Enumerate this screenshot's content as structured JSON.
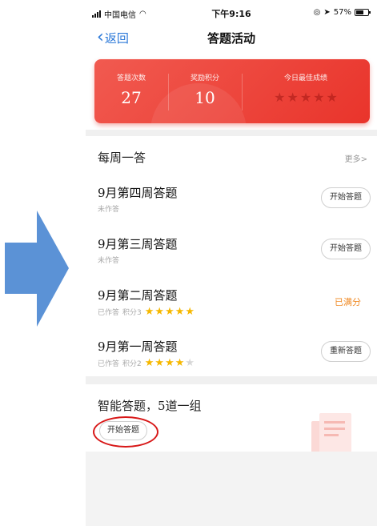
{
  "annotation": {
    "arrow_color": "#5b92d6",
    "highlight_color": "#d81818"
  },
  "status_bar": {
    "carrier": "中国电信",
    "time": "下午9:16",
    "battery": "57%"
  },
  "nav": {
    "back_label": "返回",
    "title": "答题活动"
  },
  "stats": {
    "card_color": "#ee4139",
    "items": [
      {
        "label": "答题次数",
        "value": "27"
      },
      {
        "label": "奖励积分",
        "value": "10"
      },
      {
        "label": "今日最佳成绩",
        "stars": 0,
        "max_stars": 5
      }
    ]
  },
  "weekly": {
    "title": "每周一答",
    "more_label": "更多>",
    "rows": [
      {
        "title": "9月第四周答题",
        "status": "未作答",
        "action": "开始答题"
      },
      {
        "title": "9月第三周答题",
        "status": "未作答",
        "action": "开始答题"
      },
      {
        "title": "9月第二周答题",
        "status": "已作答",
        "score": "积分3",
        "stars": 5,
        "max_stars": 5,
        "result": "已满分"
      },
      {
        "title": "9月第一周答题",
        "status": "已作答",
        "score": "积分2",
        "stars": 4,
        "max_stars": 5,
        "action": "重新答题"
      }
    ]
  },
  "smart": {
    "title": "智能答题，5道一组",
    "button": "开始答题"
  }
}
